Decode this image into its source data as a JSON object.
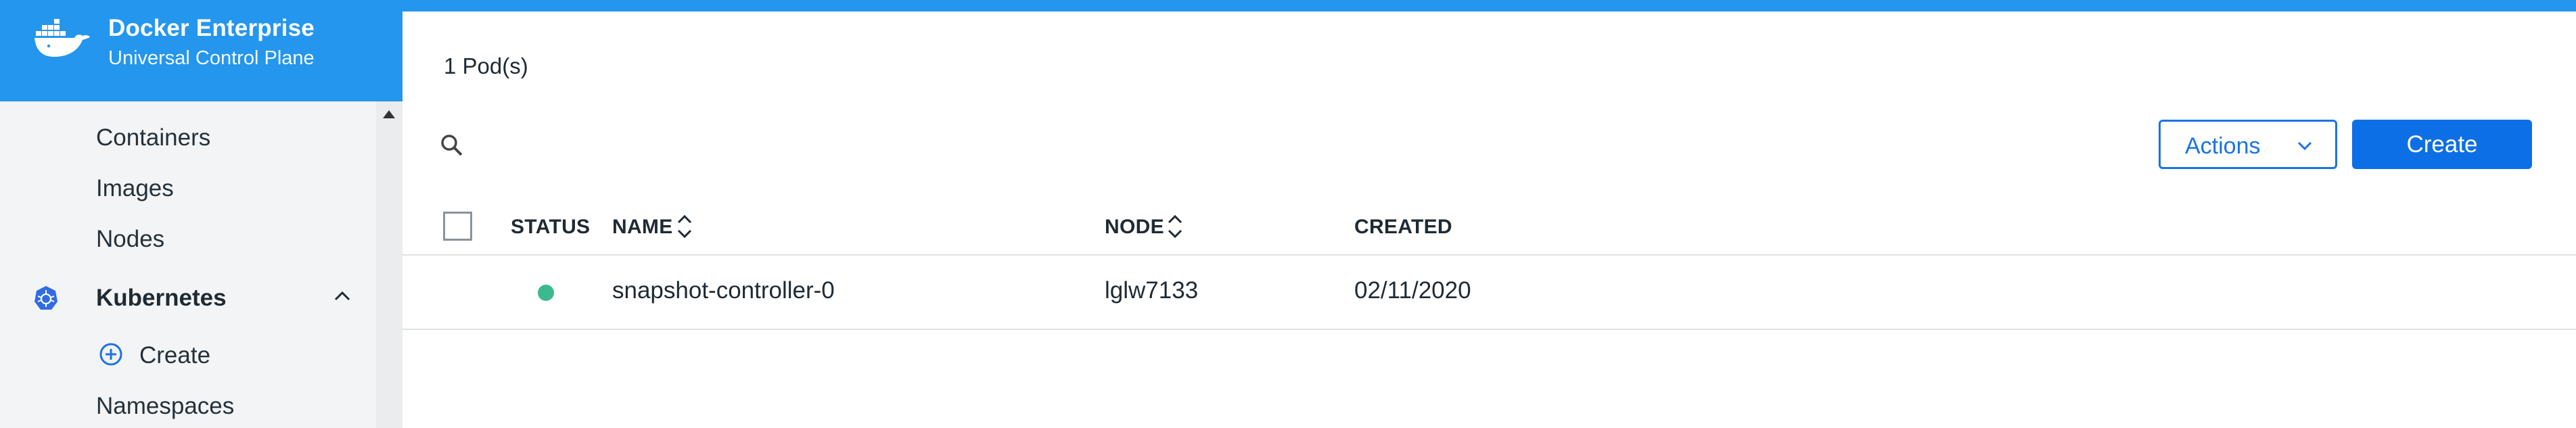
{
  "brand": {
    "title": "Docker Enterprise",
    "subtitle": "Universal Control Plane",
    "logo_icon": "docker-whale-icon"
  },
  "sidebar": {
    "items": [
      {
        "label": "Containers"
      },
      {
        "label": "Images"
      },
      {
        "label": "Nodes"
      }
    ],
    "section": {
      "label": "Kubernetes",
      "icon": "kubernetes-icon",
      "expanded": true
    },
    "sub_items": [
      {
        "label": "Create",
        "icon": "plus-circle-icon"
      },
      {
        "label": "Namespaces"
      }
    ]
  },
  "main": {
    "count_label": "1 Pod(s)",
    "toolbar": {
      "actions_label": "Actions",
      "create_label": "Create"
    },
    "table": {
      "columns": [
        "STATUS",
        "NAME",
        "NODE",
        "CREATED"
      ],
      "rows": [
        {
          "status": "running",
          "name": "snapshot-controller-0",
          "node": "lglw7133",
          "created": "02/11/2020"
        }
      ]
    }
  },
  "colors": {
    "brand_blue": "#2496ed",
    "primary_button": "#0d6fe6",
    "status_ok": "#3cb98f"
  }
}
